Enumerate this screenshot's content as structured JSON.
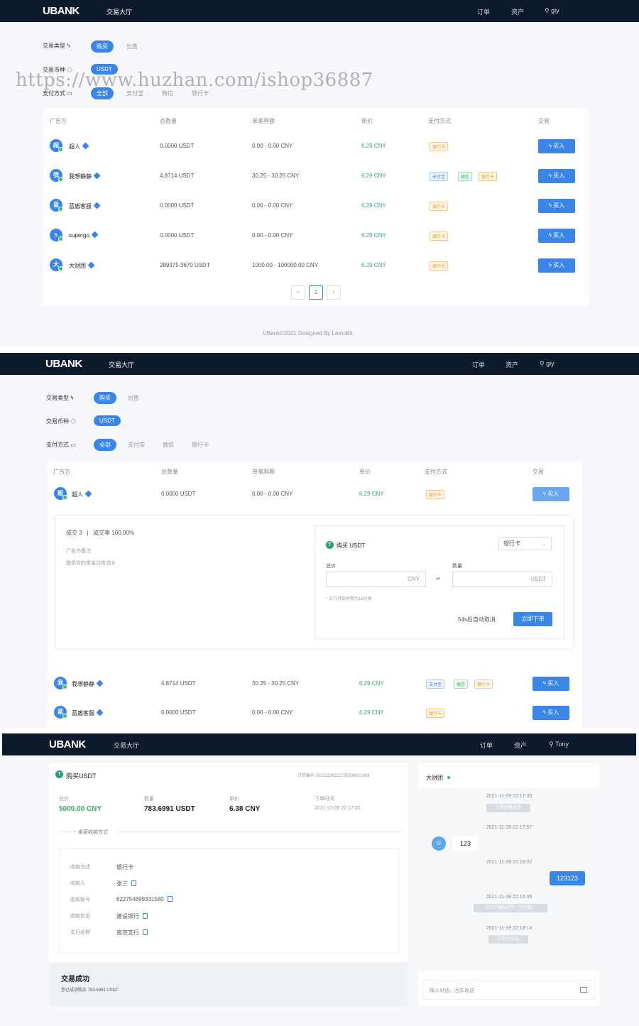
{
  "brand": {
    "logo": "UBANK"
  },
  "nav": {
    "market": "交易大厅",
    "orders": "订单",
    "assets": "资产",
    "user1": "giy",
    "user3": "Tony"
  },
  "filters": {
    "type_label": "交易类型",
    "buy": "购买",
    "sell": "出售",
    "coin_label": "交易币种",
    "coin": "USDT",
    "pay_label": "支付方式",
    "pay_options": [
      "全部",
      "支付宝",
      "微信",
      "银行卡"
    ]
  },
  "table": {
    "headers": [
      "广告方",
      "总数量",
      "单笔限额",
      "单价",
      "支付方式",
      "交易"
    ],
    "buy_label": "买入",
    "rows": [
      {
        "avatar": "超",
        "name": "超人",
        "amount": "0.0000 USDT",
        "limit": "0.00 - 0.00 CNY",
        "price": "6.29 CNY",
        "methods": [
          "银行卡"
        ]
      },
      {
        "avatar": "我",
        "name": "我想静静",
        "amount": "4.8714 USDT",
        "limit": "30.25 - 30.25 CNY",
        "price": "6.29 CNY",
        "methods": [
          "支付宝",
          "微信",
          "银行卡"
        ]
      },
      {
        "avatar": "蓝",
        "name": "蓝盾客服",
        "amount": "0.0000 USDT",
        "limit": "0.00 - 0.00 CNY",
        "price": "6.29 CNY",
        "methods": [
          "银行卡"
        ]
      },
      {
        "avatar": "s",
        "name": "supergo",
        "amount": "0.0000 USDT",
        "limit": "0.00 - 0.00 CNY",
        "price": "6.29 CNY",
        "methods": [
          "银行卡"
        ]
      },
      {
        "avatar": "大",
        "name": "大财团",
        "amount": "289375.3670 USDT",
        "limit": "1000.00 - 100000.00 CNY",
        "price": "6.29 CNY",
        "methods": [
          "银行卡"
        ]
      }
    ]
  },
  "pagination": {
    "prev": "<",
    "page": "1",
    "next": ">"
  },
  "footer": "UBank©2021 Designed By LamoBit.",
  "watermark": "https://www.huzhan.com/ishop36887",
  "detail": {
    "trades": "成交 3",
    "rate": "成交率 100.00%",
    "remark_label": "广告方备注",
    "remark": "提供你的资金过夜流水",
    "buy_title": "购买 USDT",
    "method": "银行卡",
    "total_label": "总价",
    "qty_label": "数量",
    "cny": "CNY",
    "usdt": "USDT",
    "swap": "⇌",
    "note": "* 买方付款时限为15分钟",
    "countdown": "54s后自动取消",
    "order_btn": "立即下单"
  },
  "order": {
    "title": "购买USDT",
    "order_no": "订单编号 20211128221735800021408",
    "total_label": "总价",
    "total": "5000.00 CNY",
    "qty_label": "数量",
    "qty": "783.6991 USDT",
    "price_label": "单价",
    "price": "6.38 CNY",
    "time_label": "下单时间",
    "time": "2021-11-28 22:17:35",
    "section": "卖家收款方式",
    "fields": [
      {
        "label": "收款方式",
        "value": "银行卡"
      },
      {
        "label": "收款人",
        "value": "张三"
      },
      {
        "label": "收款账号",
        "value": "6227546993315​60"
      },
      {
        "label": "收款信息",
        "value": "建设银行"
      },
      {
        "label": "支行名称",
        "value": "南京支行"
      }
    ],
    "success_title": "交易成功",
    "success_msg": "您已成功购买 783.6991 USDT"
  },
  "chat": {
    "name": "大财团",
    "t1": "2021-11-28 22:17:35",
    "s1": "订单创建成功",
    "t2": "2021-11-28 22:17:57",
    "m1": "123",
    "t3": "2021-11-28 22:18:02",
    "m2": "123123",
    "t4": "2021-11-28 22:18:06",
    "s2": "订单已被标记为「已付款」",
    "t5": "2021-11-28 22:18:14",
    "s3": "订单已完成",
    "placeholder": "输入对话，回车发送"
  },
  "colors": {
    "nav": "#0d1a2b",
    "accent": "#3a86e8",
    "price": "#2fb36a"
  }
}
